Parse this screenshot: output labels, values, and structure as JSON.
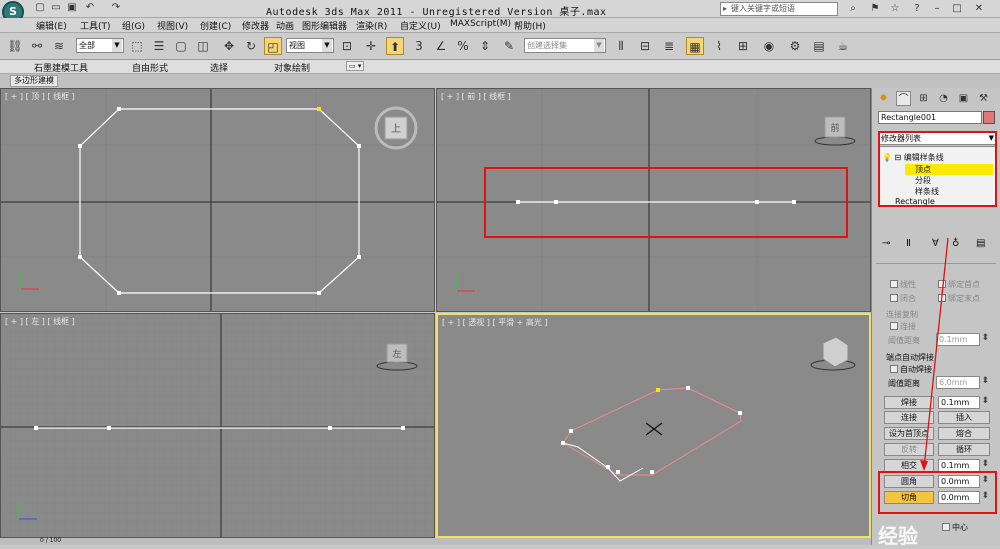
{
  "window": {
    "title": "Autodesk 3ds Max  2011  - Unregistered Version    桌子.max",
    "search_placeholder": "键入关键字或短语"
  },
  "menu": [
    "编辑(E)",
    "工具(T)",
    "组(G)",
    "视图(V)",
    "创建(C)",
    "修改器",
    "动画",
    "图形编辑器",
    "渲染(R)",
    "自定义(U)",
    "MAXScript(M)",
    "帮助(H)"
  ],
  "toolbar": {
    "selection_filter": "全部",
    "coord_system": "视图",
    "named_selection_placeholder": "创建选择集",
    "snap_label": "3"
  },
  "ribbon": {
    "tabs": [
      "石墨建模工具",
      "自由形式",
      "选择",
      "对象绘制"
    ],
    "sub_tab": "多边形建模"
  },
  "viewports": {
    "top": {
      "label": "[ + ] [ 顶 ] [ 线框 ]",
      "cube_face": "上"
    },
    "front": {
      "label": "[ + ] [ 前 ] [ 线框 ]",
      "cube_face": "前"
    },
    "left": {
      "label": "[ + ] [ 左 ] [ 线框 ]",
      "cube_face": "左"
    },
    "perspective": {
      "label": "[ + ] [ 透视 ] [ 平滑 + 高光 ]"
    }
  },
  "command_panel": {
    "object_name": "Rectangle001",
    "modifier_list": "修改器列表",
    "stack": {
      "edit_spline": "编辑样条线",
      "vertex": "顶点",
      "segment": "分段",
      "spline": "样条线",
      "base": "Rectangle"
    },
    "rollout": {
      "linear": "线性",
      "bind_first": "绑定首点",
      "closed": "闭合",
      "bind_last": "绑定末点",
      "connect_copy": "连接复制",
      "connect": "连接",
      "threshold_label": "阈值距离",
      "threshold_value": "0.1mm",
      "end_auto_weld": "端点自动焊接",
      "auto_weld": "自动焊接",
      "weld_threshold_label": "阈值距离",
      "weld_threshold_value": "6.0mm",
      "weld_button": "焊接",
      "weld_value": "0.1mm",
      "connect_button": "连接",
      "insert_button": "插入",
      "make_first_button": "设为首顶点",
      "fuse_button": "熔合",
      "reverse_button": "反转",
      "cycle_button": "循环",
      "cross_insert_button": "相交",
      "cross_insert_value": "0.1mm",
      "fillet_button": "圆角",
      "fillet_value": "0.0mm",
      "chamfer_button": "切角",
      "chamfer_value": "0.0mm",
      "center_label": "中心"
    }
  },
  "status": {
    "frame": "0 / 100"
  },
  "watermark": "经验"
}
